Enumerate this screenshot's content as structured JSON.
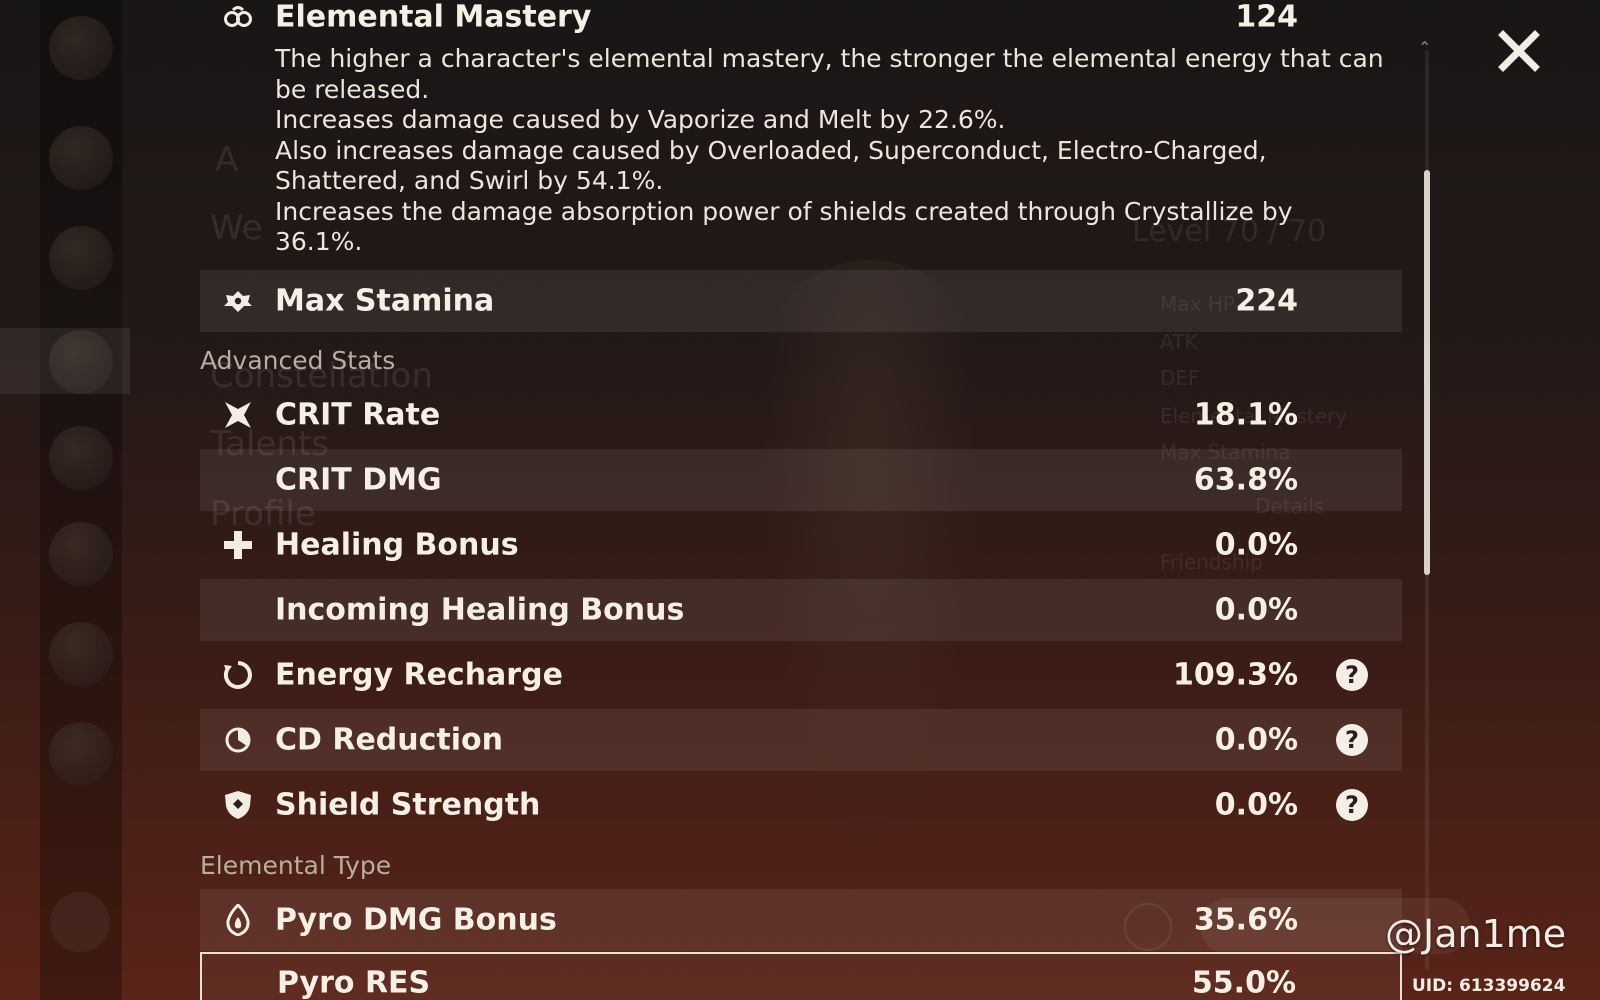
{
  "elemental_mastery": {
    "label": "Elemental Mastery",
    "value": "124",
    "icon": "elemental-mastery-icon",
    "description": [
      "The higher a character's elemental mastery, the stronger the elemental energy that can be released.",
      "Increases damage caused by Vaporize and Melt by 22.6%.",
      "Also increases damage caused by Overloaded, Superconduct, Electro-Charged, Shattered, and Swirl by 54.1%.",
      "Increases the damage absorption power of shields created through Crystallize by 36.1%."
    ]
  },
  "max_stamina": {
    "label": "Max Stamina",
    "value": "224",
    "icon": "stamina-icon"
  },
  "advanced_stats": {
    "heading": "Advanced Stats",
    "rows": [
      {
        "label": "CRIT Rate",
        "value": "18.1%",
        "icon": "crit-icon"
      },
      {
        "label": "CRIT DMG",
        "value": "63.8%"
      },
      {
        "label": "Healing Bonus",
        "value": "0.0%",
        "icon": "healing-cross-icon"
      },
      {
        "label": "Incoming Healing Bonus",
        "value": "0.0%"
      },
      {
        "label": "Energy Recharge",
        "value": "109.3%",
        "icon": "energy-recharge-icon",
        "help": "?"
      },
      {
        "label": "CD Reduction",
        "value": "0.0%",
        "icon": "cd-reduction-icon",
        "help": "?"
      },
      {
        "label": "Shield Strength",
        "value": "0.0%",
        "icon": "shield-icon",
        "help": "?"
      }
    ]
  },
  "elemental_type": {
    "heading": "Elemental Type",
    "rows": [
      {
        "label": "Pyro DMG Bonus",
        "value": "35.6%",
        "icon": "pyro-icon"
      },
      {
        "label": "Pyro RES",
        "value": "55.0%"
      }
    ]
  },
  "watermark": "@Jan1me",
  "uid": "UID: 613399624",
  "colors": {
    "text": "#f6efe4",
    "section": "#b9aca0",
    "row_shade": "rgba(255,255,255,0.075)"
  }
}
